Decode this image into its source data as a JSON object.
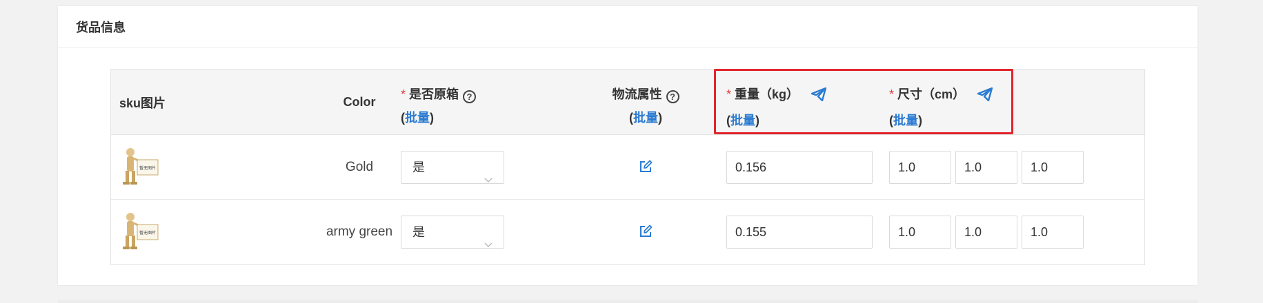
{
  "panel": {
    "title": "货品信息"
  },
  "table": {
    "headers": {
      "sku_image": "sku图片",
      "color": "Color",
      "original_box": {
        "required": "*",
        "label": "是否原箱",
        "help_icon": "question-circle-icon",
        "batch_open": "(",
        "batch": "批量",
        "batch_close": ")"
      },
      "logistics": {
        "label": "物流属性",
        "help_icon": "question-circle-icon",
        "batch_open": "(",
        "batch": "批量",
        "batch_close": ")"
      },
      "weight": {
        "required": "*",
        "label": "重量（kg）",
        "icon": "paper-plane-icon",
        "batch_open": "(",
        "batch": "批量",
        "batch_close": ")"
      },
      "size": {
        "required": "*",
        "label": "尺寸（cm）",
        "icon": "paper-plane-icon",
        "batch_open": "(",
        "batch": "批量",
        "batch_close": ")"
      }
    },
    "rows": [
      {
        "image_text": "暂无图片",
        "color": "Gold",
        "original_box": "是",
        "weight": "0.156",
        "size": [
          "1.0",
          "1.0",
          "1.0"
        ]
      },
      {
        "image_text": "暂无图片",
        "color": "army green",
        "original_box": "是",
        "weight": "0.155",
        "size": [
          "1.0",
          "1.0",
          "1.0"
        ]
      }
    ]
  },
  "colors": {
    "accent_blue": "#2b7bd1",
    "required_red": "#e4393c",
    "highlight_red": "#e3242b"
  }
}
